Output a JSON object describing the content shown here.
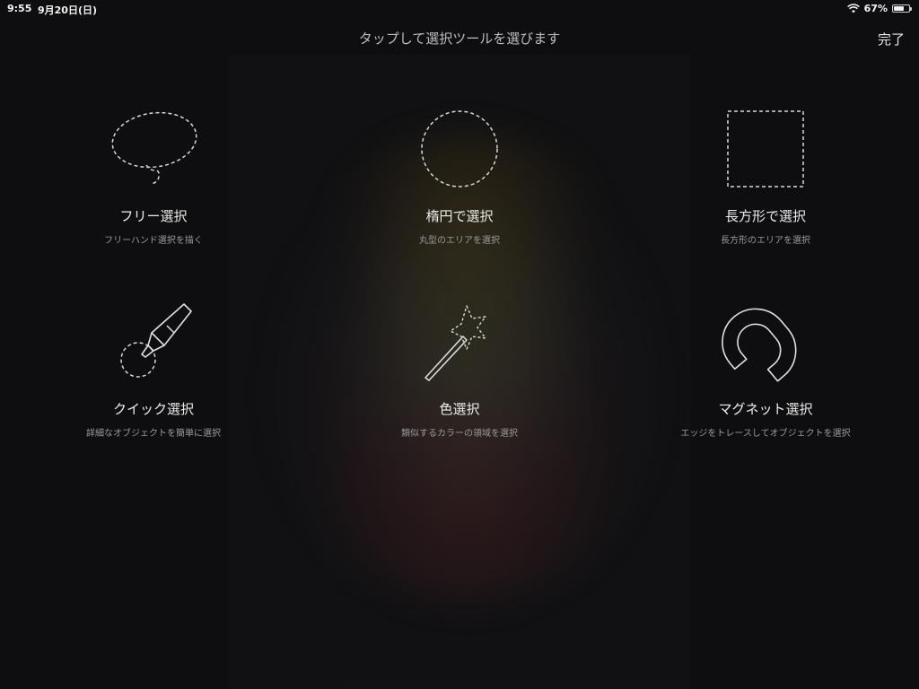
{
  "status_bar": {
    "time": "9:55",
    "date": "9月20日(日)",
    "battery": "67%",
    "battery_level": 0.67
  },
  "header": {
    "title": "タップして選択ツールを選びます",
    "done_label": "完了"
  },
  "tools": [
    {
      "label": "フリー選択",
      "description": "フリーハンド選択を描く",
      "icon": "lasso-icon"
    },
    {
      "label": "楕円で選択",
      "description": "丸型のエリアを選択",
      "icon": "ellipse-select-icon"
    },
    {
      "label": "長方形で選択",
      "description": "長方形のエリアを選択",
      "icon": "rectangle-select-icon"
    },
    {
      "label": "クイック選択",
      "description": "詳細なオブジェクトを簡単に選択",
      "icon": "quick-select-marker-icon"
    },
    {
      "label": "色選択",
      "description": "類似するカラーの領域を選択",
      "icon": "magic-wand-icon"
    },
    {
      "label": "マグネット選択",
      "description": "エッジをトレースしてオブジェクトを選択",
      "icon": "magnet-icon"
    }
  ]
}
